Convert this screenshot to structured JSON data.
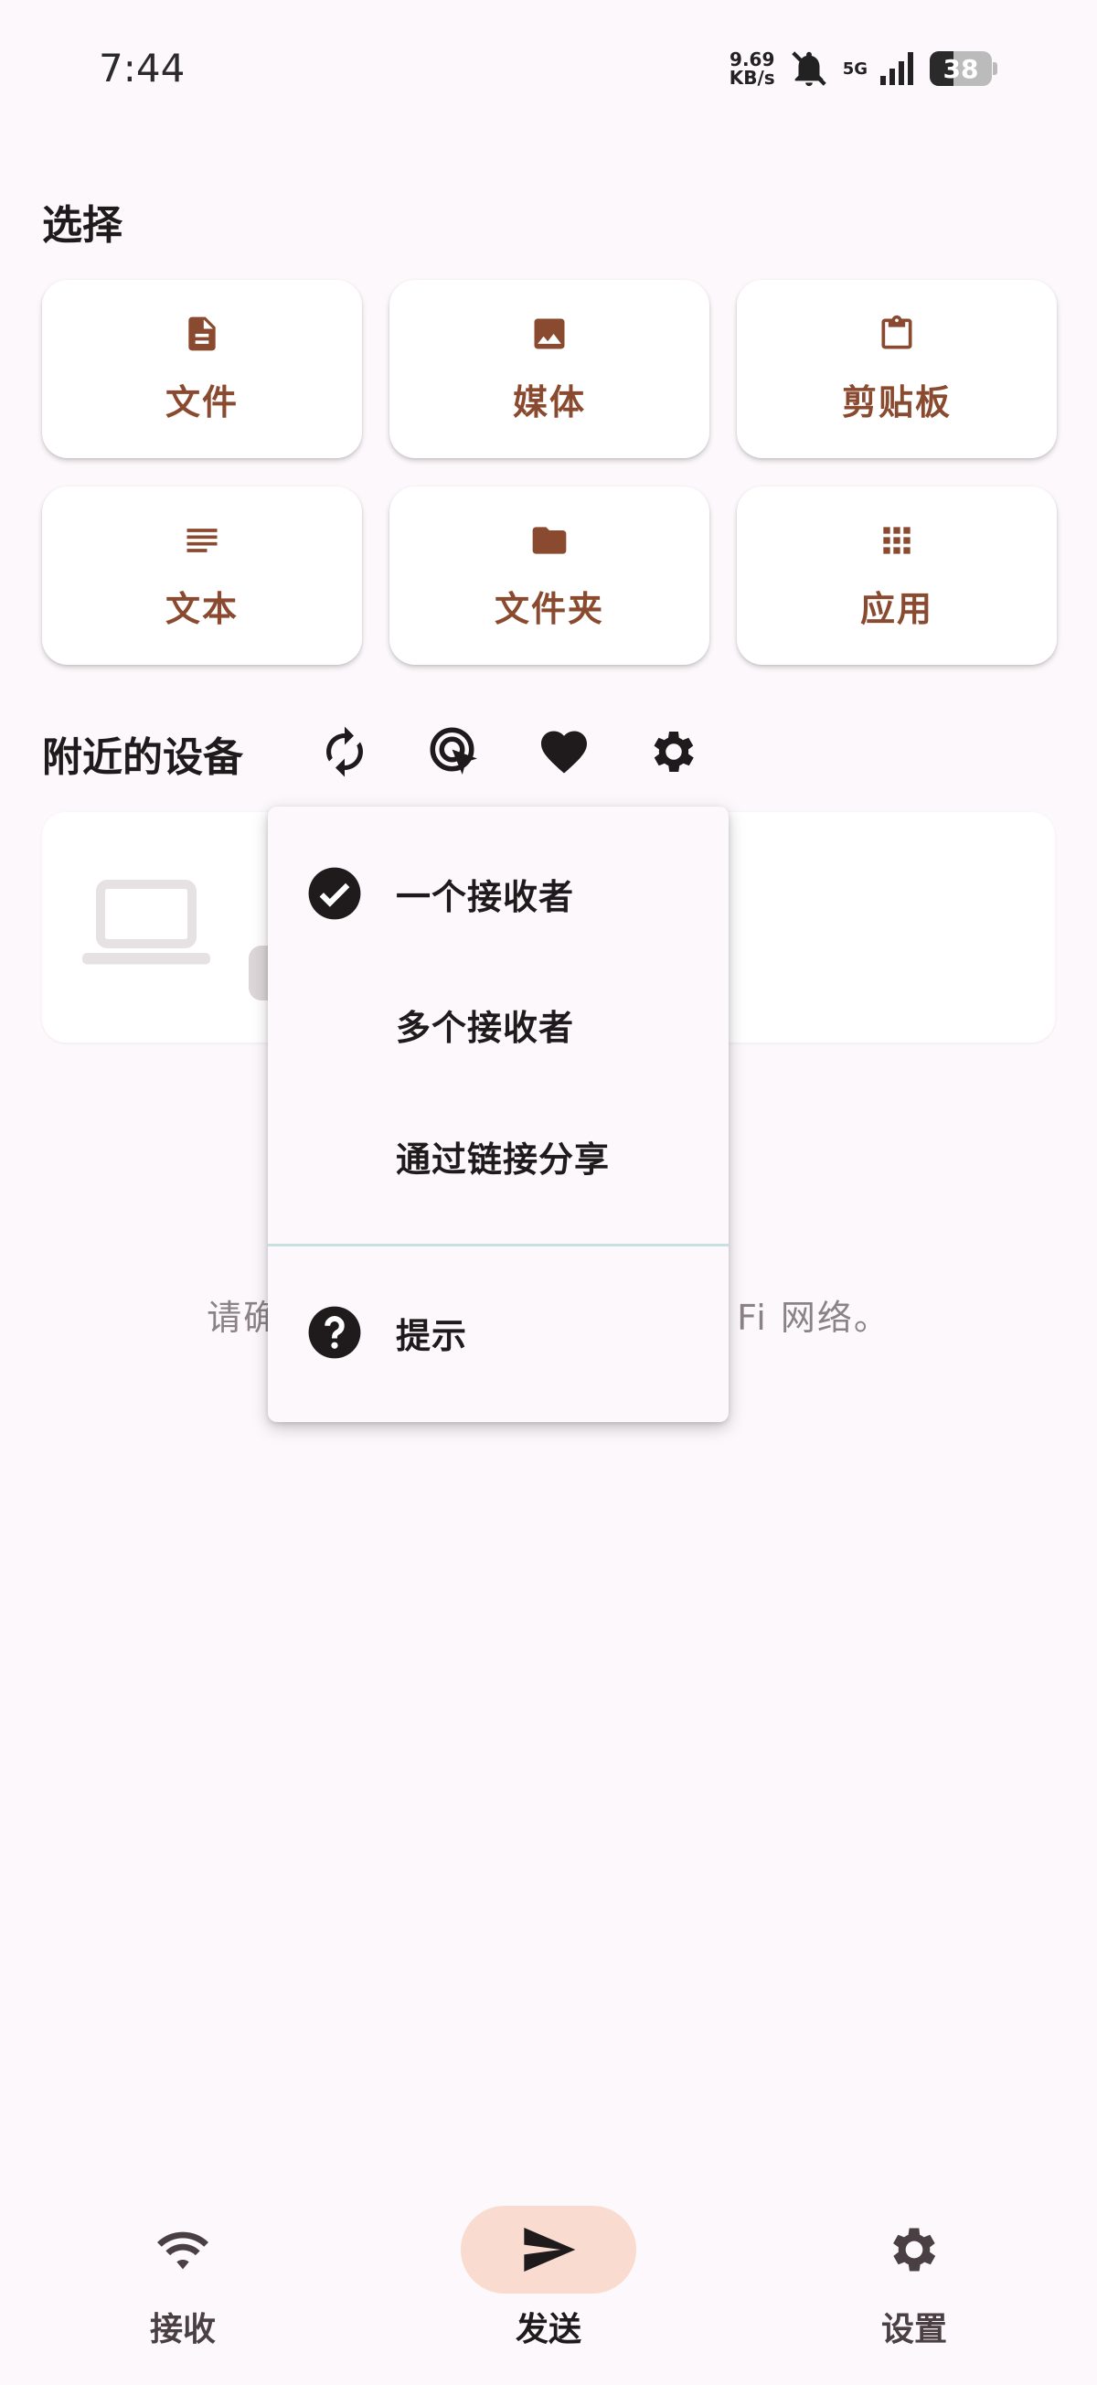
{
  "status": {
    "time": "7:44",
    "net_speed_value": "9.69",
    "net_speed_unit": "KB/s",
    "network": "5G",
    "battery": "38"
  },
  "select_section": {
    "title": "选择",
    "items": [
      {
        "label": "文件",
        "icon": "file-icon"
      },
      {
        "label": "媒体",
        "icon": "image-icon"
      },
      {
        "label": "剪贴板",
        "icon": "clipboard-icon"
      },
      {
        "label": "文本",
        "icon": "text-icon"
      },
      {
        "label": "文件夹",
        "icon": "folder-icon"
      },
      {
        "label": "应用",
        "icon": "apps-grid-icon"
      }
    ]
  },
  "nearby": {
    "title": "附近的设备",
    "hint_left": "请确",
    "hint_right": "Fi 网络。"
  },
  "menu": {
    "items": [
      {
        "label": "一个接收者",
        "icon": "check-circle-icon",
        "selected": true
      },
      {
        "label": "多个接收者",
        "icon": "",
        "selected": false
      },
      {
        "label": "通过链接分享",
        "icon": "",
        "selected": false
      },
      {
        "label": "提示",
        "icon": "help-circle-icon",
        "selected": false
      }
    ]
  },
  "bottom_nav": {
    "items": [
      {
        "label": "接收",
        "icon": "wifi-icon",
        "active": false
      },
      {
        "label": "发送",
        "icon": "send-icon",
        "active": true
      },
      {
        "label": "设置",
        "icon": "gear-icon",
        "active": false
      }
    ]
  },
  "colors": {
    "accent_brown": "#8a4a30",
    "active_pill": "#f9dbd0",
    "background": "#fdf8fb"
  }
}
